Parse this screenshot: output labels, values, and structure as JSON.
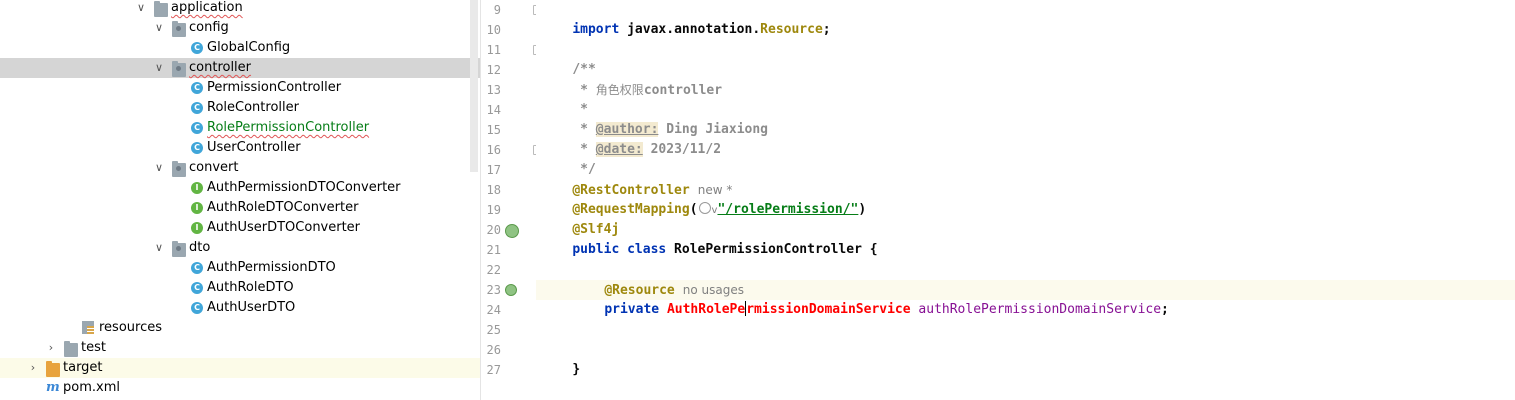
{
  "tree": {
    "items": [
      {
        "label": "application",
        "icon": "folder-icon",
        "expanded": true
      },
      {
        "label": "config",
        "icon": "folder-icon",
        "expanded": true
      },
      {
        "label": "GlobalConfig",
        "icon": "class-icon"
      },
      {
        "label": "controller",
        "icon": "folder-icon",
        "expanded": true,
        "selected": true
      },
      {
        "label": "PermissionController",
        "icon": "class-icon"
      },
      {
        "label": "RoleController",
        "icon": "class-icon"
      },
      {
        "label": "RolePermissionController",
        "icon": "class-icon",
        "status": "new"
      },
      {
        "label": "UserController",
        "icon": "class-icon"
      },
      {
        "label": "convert",
        "icon": "folder-icon",
        "expanded": true
      },
      {
        "label": "AuthPermissionDTOConverter",
        "icon": "interface-icon"
      },
      {
        "label": "AuthRoleDTOConverter",
        "icon": "interface-icon"
      },
      {
        "label": "AuthUserDTOConverter",
        "icon": "interface-icon"
      },
      {
        "label": "dto",
        "icon": "folder-icon",
        "expanded": true
      },
      {
        "label": "AuthPermissionDTO",
        "icon": "class-icon"
      },
      {
        "label": "AuthRoleDTO",
        "icon": "class-icon"
      },
      {
        "label": "AuthUserDTO",
        "icon": "class-icon"
      },
      {
        "label": "resources",
        "icon": "resources-folder-icon"
      },
      {
        "label": "test",
        "icon": "folder-icon",
        "expanded": false
      },
      {
        "label": "target",
        "icon": "excluded-folder-icon",
        "expanded": false
      },
      {
        "label": "pom.xml",
        "icon": "maven-icon"
      }
    ],
    "icon_letters": {
      "class": "C",
      "interface": "I",
      "maven": "m"
    }
  },
  "editor": {
    "line_numbers": [
      "9",
      "10",
      "11",
      "12",
      "13",
      "14",
      "15",
      "16",
      "17",
      "18",
      "19",
      "20",
      "21",
      "22",
      "23",
      "24",
      "25",
      "26",
      "27"
    ],
    "lines": {
      "l9_kw": "import",
      "l9_rest": " javax.annotation.",
      "l9_cls": "Resource",
      "l9_end": ";",
      "l11": "/**",
      "l12_star": " * ",
      "l12_cjk": "角色权限",
      "l12_word": "controller",
      "l13": " *",
      "l14_star": " * ",
      "l14_tag": "@author:",
      "l14_val": " Ding Jiaxiong",
      "l15_star": " * ",
      "l15_tag": "@date:",
      "l15_val": " 2023/11/2",
      "l16": " */",
      "l17_ann": "@RestController",
      "l17_hint": "new *",
      "l18_ann": "@RequestMapping",
      "l18_open": "(",
      "l18_chev": "v",
      "l18_str": "\"/rolePermission/\"",
      "l18_close": ")",
      "l19_ann": "@Slf4j",
      "l20_kw": "public class",
      "l20_name": " RolePermissionController {",
      "l22_ann": "@Resource",
      "l22_hint": "no usages",
      "l23_kw": "private",
      "l23_type_a": "AuthRolePe",
      "l23_type_b": "rmissionDomainService",
      "l23_field": " authRolePermissionDomainService",
      "l23_end": ";",
      "l26": "}"
    }
  },
  "colors": {
    "keyword": "#0033b3",
    "annotation": "#9e880d",
    "string": "#067d17",
    "error_class": "#ff0000",
    "comment": "#8c8c8c",
    "selection": "#d5d5d5",
    "current_line": "#fcfaed"
  }
}
